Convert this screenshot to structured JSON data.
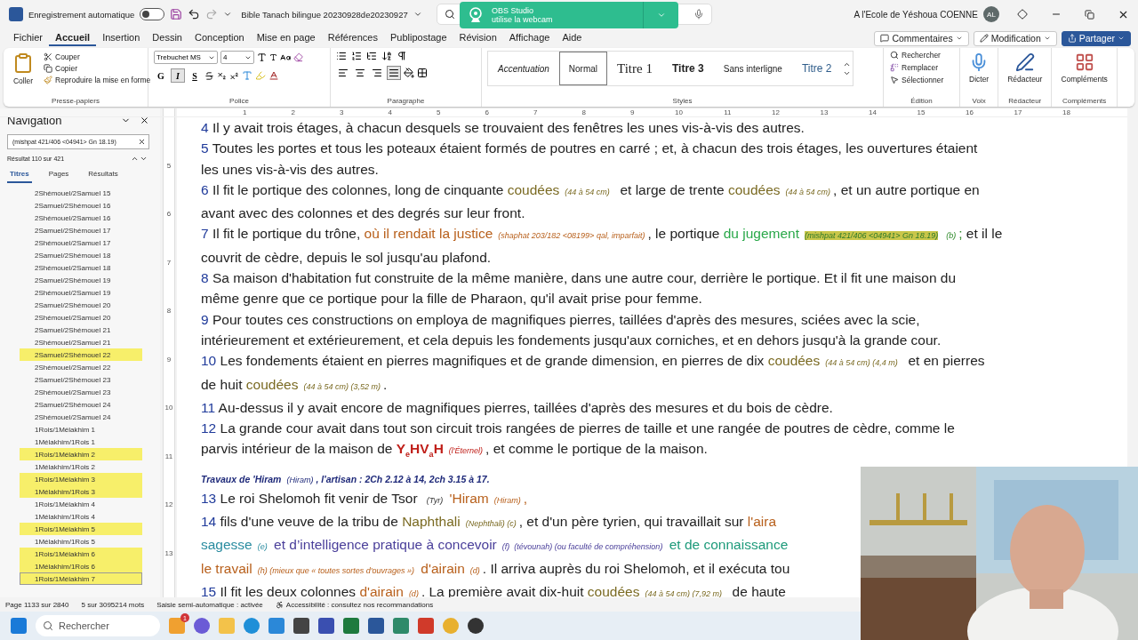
{
  "title_bar": {
    "autosave_label": "Enregistrement automatique",
    "autosave_on": false,
    "document_title": "Bible Tanach bilingue 20230928de20230927",
    "user_name": "A l'Ecole de Yéshoua COENNE",
    "avatar_initials": "AL"
  },
  "notification": {
    "title": "OBS Studio",
    "message": "utilise la webcam"
  },
  "menu_tabs": [
    {
      "label": "Fichier",
      "selected": false
    },
    {
      "label": "Accueil",
      "selected": true
    },
    {
      "label": "Insertion",
      "selected": false
    },
    {
      "label": "Dessin",
      "selected": false
    },
    {
      "label": "Conception",
      "selected": false
    },
    {
      "label": "Mise en page",
      "selected": false
    },
    {
      "label": "Références",
      "selected": false
    },
    {
      "label": "Publipostage",
      "selected": false
    },
    {
      "label": "Révision",
      "selected": false
    },
    {
      "label": "Affichage",
      "selected": false
    },
    {
      "label": "Aide",
      "selected": false
    }
  ],
  "header_buttons": [
    {
      "label": "Commentaires",
      "kind": "comments"
    },
    {
      "label": "Modification",
      "kind": "editing"
    },
    {
      "label": "Partager",
      "kind": "share"
    }
  ],
  "ribbon": {
    "clipboard": {
      "paste": "Coller",
      "items": [
        "Couper",
        "Copier",
        "Reproduire la mise en forme"
      ],
      "label": "Presse-papiers"
    },
    "font": {
      "family": "Trebuchet MS",
      "size": "4",
      "label": "Police",
      "format_buttons": [
        {
          "text": "G",
          "selected": false
        },
        {
          "text": "I",
          "selected": true
        },
        {
          "text": "S",
          "selected": false
        }
      ]
    },
    "paragraph": {
      "label": "Paragraphe",
      "alignments": [
        {
          "selected": false
        },
        {
          "selected": false
        },
        {
          "selected": false
        },
        {
          "selected": true
        }
      ]
    },
    "styles": {
      "label": "Styles",
      "items": [
        {
          "text": "Accentuation",
          "kind": "emphasis",
          "selected": false
        },
        {
          "text": "Normal",
          "kind": "normal",
          "selected": true
        },
        {
          "text": "Titre 1",
          "kind": "title1",
          "selected": false
        },
        {
          "text": "Titre 3",
          "kind": "title3",
          "selected": false
        },
        {
          "text": "Sans interligne",
          "kind": "nospacing",
          "selected": false
        },
        {
          "text": "Titre 2",
          "kind": "title2",
          "selected": false
        }
      ]
    },
    "editing": {
      "label": "Édition",
      "items": [
        "Rechercher",
        "Remplacer",
        "Sélectionner"
      ]
    },
    "big_groups": [
      {
        "button": "Dicter",
        "label": "Voix",
        "kind": "mic"
      },
      {
        "button": "Rédacteur",
        "label": "Rédacteur",
        "kind": "editor"
      },
      {
        "button": "Compléments",
        "label": "Compléments",
        "kind": "addins"
      }
    ]
  },
  "navigation": {
    "title": "Navigation",
    "search_value": "(mishpat 421/406 <04941> Gn 18.19)",
    "result_count": "Résultat 110 sur 421",
    "tabs": [
      {
        "label": "Titres",
        "selected": true
      },
      {
        "label": "Pages",
        "selected": false
      },
      {
        "label": "Résultats",
        "selected": false
      }
    ],
    "headings": [
      {
        "text": "2Shémouel/2Samuel 15",
        "highlighted": false,
        "selected": false
      },
      {
        "text": "2Samuel/2Shémouel 16",
        "highlighted": false,
        "selected": false
      },
      {
        "text": "2Shémouel/2Samuel 16",
        "highlighted": false,
        "selected": false
      },
      {
        "text": "2Samuel/2Shémouel 17",
        "highlighted": false,
        "selected": false
      },
      {
        "text": "2Shémouel/2Samuel 17",
        "highlighted": false,
        "selected": false
      },
      {
        "text": "2Samuel/2Shémouel 18",
        "highlighted": false,
        "selected": false
      },
      {
        "text": "2Shémouel/2Samuel 18",
        "highlighted": false,
        "selected": false
      },
      {
        "text": "2Samuel/2Shémouel 19",
        "highlighted": false,
        "selected": false
      },
      {
        "text": "2Shémouel/2Samuel 19",
        "highlighted": false,
        "selected": false
      },
      {
        "text": "2Samuel/2Shémouel 20",
        "highlighted": false,
        "selected": false
      },
      {
        "text": "2Shémouel/2Samuel 20",
        "highlighted": false,
        "selected": false
      },
      {
        "text": "2Samuel/2Shémouel 21",
        "highlighted": false,
        "selected": false
      },
      {
        "text": "2Shémouel/2Samuel 21",
        "highlighted": false,
        "selected": false
      },
      {
        "text": "2Samuel/2Shémouel 22",
        "highlighted": true,
        "selected": false
      },
      {
        "text": "2Shémouel/2Samuel 22",
        "highlighted": false,
        "selected": false
      },
      {
        "text": "2Samuel/2Shémouel 23",
        "highlighted": false,
        "selected": false
      },
      {
        "text": "2Shémouel/2Samuel 23",
        "highlighted": false,
        "selected": false
      },
      {
        "text": "2Samuel/2Shémouel 24",
        "highlighted": false,
        "selected": false
      },
      {
        "text": "2Shémouel/2Samuel 24",
        "highlighted": false,
        "selected": false
      },
      {
        "text": "1Rois/1Mélakhim 1",
        "highlighted": false,
        "selected": false
      },
      {
        "text": "1Mélakhim/1Rois 1",
        "highlighted": false,
        "selected": false
      },
      {
        "text": "1Rois/1Mélakhim 2",
        "highlighted": true,
        "selected": false
      },
      {
        "text": "1Mélakhim/1Rois 2",
        "highlighted": false,
        "selected": false
      },
      {
        "text": "1Rois/1Mélakhim 3",
        "highlighted": true,
        "selected": false
      },
      {
        "text": "1Mélakhim/1Rois 3",
        "highlighted": true,
        "selected": false
      },
      {
        "text": "1Rois/1Mélakhim 4",
        "highlighted": false,
        "selected": false
      },
      {
        "text": "1Mélakhim/1Rois 4",
        "highlighted": false,
        "selected": false
      },
      {
        "text": "1Rois/1Mélakhim 5",
        "highlighted": true,
        "selected": false
      },
      {
        "text": "1Mélakhim/1Rois 5",
        "highlighted": false,
        "selected": false
      },
      {
        "text": "1Rois/1Mélakhim 6",
        "highlighted": true,
        "selected": false
      },
      {
        "text": "1Mélakhim/1Rois 6",
        "highlighted": true,
        "selected": false
      },
      {
        "text": "1Rois/1Mélakhim 7",
        "highlighted": true,
        "selected": true
      }
    ]
  },
  "rulers": {
    "horizontal": [
      "1",
      "2",
      "3",
      "4",
      "5",
      "6",
      "7",
      "8",
      "9",
      "10",
      "11",
      "12",
      "13",
      "14",
      "15",
      "16",
      "17",
      "18"
    ],
    "vertical": [
      "5",
      "6",
      "7",
      "8",
      "9",
      "10",
      "11",
      "12",
      "13"
    ]
  },
  "document": {
    "lines": [
      {
        "kind": "body",
        "segments": [
          {
            "kind": "verse",
            "text": "4"
          },
          {
            "kind": "text",
            "text": " Il y avait trois étages, à chacun desquels se trouvaient des fenêtres les unes vis-à-vis des autres."
          }
        ]
      },
      {
        "kind": "body",
        "segments": [
          {
            "kind": "verse",
            "text": "5"
          },
          {
            "kind": "text",
            "text": " Toutes les portes et tous les poteaux étaient formés de poutres en carré ; et, à chacun des trois étages, les ouvertures étaient"
          }
        ]
      },
      {
        "kind": "body",
        "segments": [
          {
            "kind": "text",
            "text": "les unes vis-à-vis des autres."
          }
        ]
      },
      {
        "kind": "body",
        "segments": [
          {
            "kind": "verse",
            "text": "6"
          },
          {
            "kind": "text",
            "text": " Il fit le portique des colonnes, long de cinquante "
          },
          {
            "kind": "term",
            "text": "coudées",
            "color": "#7a6a22"
          },
          {
            "kind": "note",
            "text": "(44 à 54 cm)"
          },
          {
            "kind": "text",
            "text": "  et large de trente "
          },
          {
            "kind": "term",
            "text": "coudées",
            "color": "#7a6a22"
          },
          {
            "kind": "note",
            "text": "(44 à 54 cm)"
          },
          {
            "kind": "text",
            "text": ", et un autre portique en"
          }
        ]
      },
      {
        "kind": "body",
        "segments": [
          {
            "kind": "text",
            "text": "avant avec des colonnes et des degrés sur leur front."
          }
        ]
      },
      {
        "kind": "body",
        "segments": [
          {
            "kind": "verse",
            "text": "7"
          },
          {
            "kind": "text",
            "text": " Il fit le portique du trône, "
          },
          {
            "kind": "term",
            "text": "où il rendait la justice",
            "color": "#b8601c"
          },
          {
            "kind": "note",
            "text": "(shaphat 203/182 <08199> qal, imparfait)"
          },
          {
            "kind": "text",
            "text": ", le portique "
          },
          {
            "kind": "term",
            "text": "du jugement",
            "color": "#2aa84a"
          },
          {
            "kind": "highlight",
            "text": "(mishpat 421/406 <04941> Gn 18.19)"
          },
          {
            "kind": "note",
            "text": "(b)"
          },
          {
            "kind": "punct",
            "text": ";"
          },
          {
            "kind": "text",
            "text": " et il le"
          }
        ]
      },
      {
        "kind": "body",
        "segments": [
          {
            "kind": "text",
            "text": "couvrit de cèdre, depuis le sol jusqu'au plafond."
          }
        ]
      },
      {
        "kind": "body",
        "segments": [
          {
            "kind": "verse",
            "text": "8"
          },
          {
            "kind": "text",
            "text": " Sa maison d'habitation fut construite de la même manière, dans une autre cour, derrière le portique. Et il fit une maison du"
          }
        ]
      },
      {
        "kind": "body",
        "segments": [
          {
            "kind": "text",
            "text": "même genre que ce portique pour la fille de Pharaon, qu'il avait prise pour femme."
          }
        ]
      },
      {
        "kind": "body",
        "segments": [
          {
            "kind": "verse",
            "text": "9"
          },
          {
            "kind": "text",
            "text": " Pour toutes ces constructions on employa de magnifiques pierres, taillées d'après des mesures, sciées avec la scie,"
          }
        ]
      },
      {
        "kind": "body",
        "segments": [
          {
            "kind": "text",
            "text": "intérieurement et extérieurement, et cela depuis les fondements jusqu'aux corniches, et en dehors jusqu'à la grande cour."
          }
        ]
      },
      {
        "kind": "body",
        "segments": [
          {
            "kind": "verse",
            "text": "10"
          },
          {
            "kind": "text",
            "text": " Les fondements étaient en pierres magnifiques et de grande dimension, en pierres de dix "
          },
          {
            "kind": "term",
            "text": "coudées",
            "color": "#7a6a22"
          },
          {
            "kind": "note",
            "text": "(44 à 54 cm) (4,4 m)"
          },
          {
            "kind": "text",
            "text": "  et en pierres"
          }
        ]
      },
      {
        "kind": "body",
        "segments": [
          {
            "kind": "text",
            "text": "de huit "
          },
          {
            "kind": "term",
            "text": "coudées",
            "color": "#7a6a22"
          },
          {
            "kind": "note",
            "text": "(44 à 54 cm) (3,52 m)"
          },
          {
            "kind": "text",
            "text": "."
          }
        ]
      },
      {
        "kind": "body",
        "segments": [
          {
            "kind": "verse",
            "text": "11"
          },
          {
            "kind": "text",
            "text": " Au-dessus il y avait encore de magnifiques pierres, taillées d'après des mesures et du bois de cèdre."
          }
        ]
      },
      {
        "kind": "body",
        "segments": [
          {
            "kind": "verse",
            "text": "12"
          },
          {
            "kind": "text",
            "text": " La grande cour avait dans tout son circuit trois rangées de pierres de taille et une rangée de poutres de cèdre, comme le"
          }
        ]
      },
      {
        "kind": "body",
        "segments": [
          {
            "kind": "text",
            "text": "parvis intérieur de la maison de "
          },
          {
            "kind": "divine",
            "text": "Y$_{e}$HV$_{a}$H"
          },
          {
            "kind": "note",
            "text": "(l'Éternel)"
          },
          {
            "kind": "text",
            "text": ", et comme le portique de la maison."
          }
        ]
      },
      {
        "kind": "heading",
        "segments": [
          {
            "kind": "heading",
            "text": "Travaux de 'Hiram"
          },
          {
            "kind": "note",
            "text": "(Hiram)"
          },
          {
            "kind": "heading",
            "text": ", l'artisan : 2Ch 2.12 à 14, 2ch 3.15 à 17."
          }
        ]
      },
      {
        "kind": "body",
        "segments": [
          {
            "kind": "verse",
            "text": "13"
          },
          {
            "kind": "text",
            "text": " Le roi Shelomoh fit venir de Tsor "
          },
          {
            "kind": "note",
            "text": "(Tyr)"
          },
          {
            "kind": "term",
            "text": " 'Hiram",
            "color": "#b8601c"
          },
          {
            "kind": "note",
            "text": "(Hiram)"
          },
          {
            "kind": "punct",
            "text": ","
          }
        ]
      },
      {
        "kind": "body",
        "segments": [
          {
            "kind": "verse",
            "text": "14"
          },
          {
            "kind": "text",
            "text": " fils d'une veuve de la tribu de "
          },
          {
            "kind": "term",
            "text": "Naphthali",
            "color": "#7a6a22"
          },
          {
            "kind": "note",
            "text": "(Nephthali) (c)"
          },
          {
            "kind": "text",
            "text": ", et d'un père tyrien, qui travaillait sur "
          },
          {
            "kind": "term",
            "text": "l'aira",
            "color": "#b8601c"
          }
        ]
      },
      {
        "kind": "body",
        "segments": [
          {
            "kind": "term",
            "text": "sagesse",
            "color": "#2a8ca0"
          },
          {
            "kind": "note",
            "text": "(e)"
          },
          {
            "kind": "term",
            "text": " et d’intelligence pratique à concevoir",
            "color": "#4a3f9a"
          },
          {
            "kind": "note",
            "text": "(f)  (tévounah) (ou faculté de compréhension)"
          },
          {
            "kind": "term",
            "text": " et de connaissance",
            "color": "#1d9a7a"
          }
        ]
      },
      {
        "kind": "body",
        "segments": [
          {
            "kind": "term",
            "text": "le travail",
            "color": "#b8601c"
          },
          {
            "kind": "note",
            "text": "(h) (mieux que « toutes sortes d'ouvrages »)"
          },
          {
            "kind": "term",
            "text": " d'airain",
            "color": "#b8601c"
          },
          {
            "kind": "note",
            "text": "(d)"
          },
          {
            "kind": "text",
            "text": ". Il arriva auprès du roi Shelomoh, et il exécuta tou"
          }
        ]
      },
      {
        "kind": "body",
        "segments": [
          {
            "kind": "verse",
            "text": "15"
          },
          {
            "kind": "text",
            "text": " Il fit les deux colonnes "
          },
          {
            "kind": "term",
            "text": "d'airain",
            "color": "#b8601c"
          },
          {
            "kind": "note",
            "text": "(d)"
          },
          {
            "kind": "text",
            "text": ". La première avait dix-huit "
          },
          {
            "kind": "term",
            "text": "coudées",
            "color": "#7a6a22"
          },
          {
            "kind": "note",
            "text": "(44 à 54 cm) (7,92 m)"
          },
          {
            "kind": "text",
            "text": "  de haute"
          }
        ]
      }
    ]
  },
  "status_bar": [
    {
      "text": "Page 1133 sur 2840",
      "kind": "plain"
    },
    {
      "text": "5 sur 3095214 mots",
      "kind": "plain"
    },
    {
      "text": "Saisie semi-automatique : activée",
      "kind": "plain"
    },
    {
      "text": "Accessibilité : consultez nos recommandations",
      "kind": "accessibility"
    }
  ],
  "taskbar": {
    "search_placeholder": "Rechercher",
    "badge": "1"
  }
}
